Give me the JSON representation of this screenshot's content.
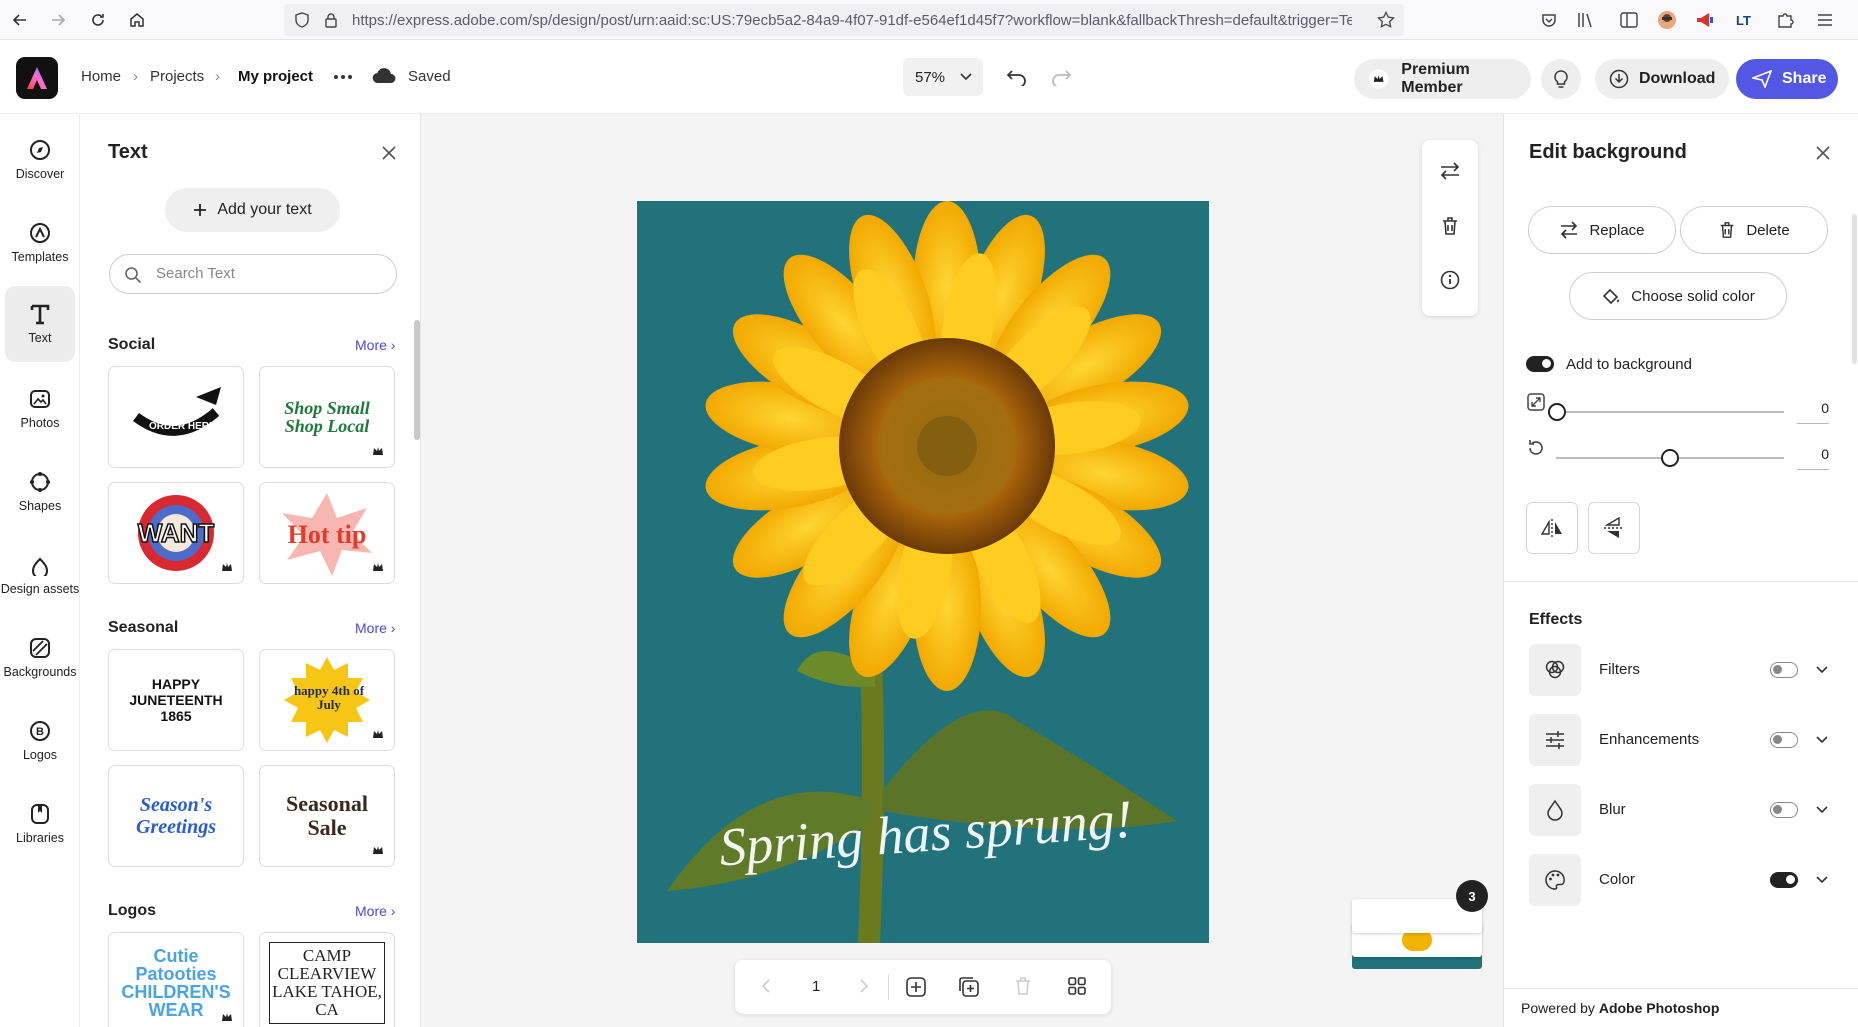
{
  "browser": {
    "url": "https://express.adobe.com/sp/design/post/urn:aaid:sc:US:79ecb5a2-84a9-4f07-91df-e564ef1d45f7?workflow=blank&fallbackThresh=default&trigger=Te"
  },
  "header": {
    "breadcrumb": [
      "Home",
      "Projects",
      "My project"
    ],
    "saved_label": "Saved",
    "zoom": "57%",
    "premium_label": "Premium Member",
    "download_label": "Download",
    "share_label": "Share"
  },
  "leftrail": {
    "items": [
      {
        "label": "Discover",
        "icon": "compass-icon"
      },
      {
        "label": "Templates",
        "icon": "templates-icon"
      },
      {
        "label": "Text",
        "icon": "text-icon"
      },
      {
        "label": "Photos",
        "icon": "photos-icon"
      },
      {
        "label": "Shapes",
        "icon": "shapes-icon"
      },
      {
        "label": "Design assets",
        "icon": "design-assets-icon"
      },
      {
        "label": "Backgrounds",
        "icon": "backgrounds-icon"
      },
      {
        "label": "Logos",
        "icon": "logos-icon"
      },
      {
        "label": "Libraries",
        "icon": "libraries-icon"
      }
    ]
  },
  "textpanel": {
    "title": "Text",
    "add_text_label": "Add your text",
    "search_placeholder": "Search Text",
    "more_label": "More",
    "sections": [
      {
        "title": "Social",
        "cards": [
          "ORDER HERE",
          "Shop Small Shop Local",
          "WANT",
          "Hot tip"
        ]
      },
      {
        "title": "Seasonal",
        "cards": [
          "HAPPY JUNETEENTH 1865",
          "happy 4th of July",
          "Season's Greetings",
          "Seasonal Sale"
        ]
      },
      {
        "title": "Logos",
        "cards": [
          "Cutie Patooties CHILDREN'S WEAR",
          "CAMP CLEARVIEW LAKE TAHOE, CA"
        ]
      }
    ]
  },
  "canvas": {
    "background_color": "#21727a",
    "overlay_text": "Spring has sprung!",
    "page_number": "1",
    "pages_badge": "3"
  },
  "editpanel": {
    "title": "Edit background",
    "replace_label": "Replace",
    "delete_label": "Delete",
    "solid_color_label": "Choose solid color",
    "add_to_background_label": "Add to background",
    "scale_value": "0",
    "rotate_value": "0",
    "effects_title": "Effects",
    "effects": [
      {
        "label": "Filters",
        "on": false
      },
      {
        "label": "Enhancements",
        "on": false
      },
      {
        "label": "Blur",
        "on": false
      },
      {
        "label": "Color",
        "on": true
      }
    ],
    "powered_prefix": "Powered by",
    "powered_brand": "Adobe Photoshop"
  },
  "colors": {
    "accent": "#5258e4",
    "canvas_teal": "#21727a",
    "link": "#4a4ad4"
  }
}
